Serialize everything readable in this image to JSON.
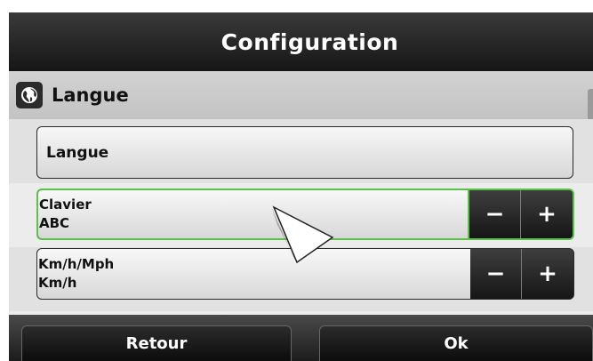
{
  "header": {
    "title": "Configuration"
  },
  "section": {
    "title": "Langue",
    "icon": "globe-icon"
  },
  "language_button": {
    "label": "Langue"
  },
  "settings": [
    {
      "label": "Clavier",
      "value": "ABC",
      "focused": true,
      "minus": "−",
      "plus": "+"
    },
    {
      "label": "Km/h/Mph",
      "value": "Km/h",
      "focused": false,
      "minus": "−",
      "plus": "+"
    }
  ],
  "footer": {
    "back_label": "Retour",
    "ok_label": "Ok"
  },
  "colors": {
    "focus": "#5cc24a",
    "titlebar": "#1f1f1f"
  }
}
